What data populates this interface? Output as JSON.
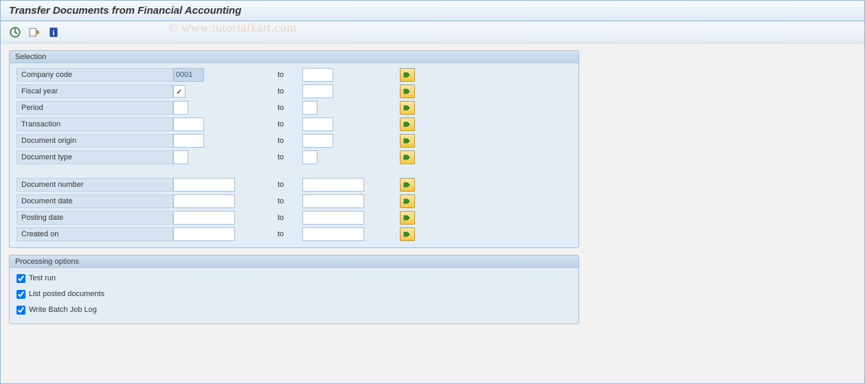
{
  "title": "Transfer Documents from Financial Accounting",
  "watermark": "© www.tutorialkart.com",
  "groups": {
    "selection": {
      "title": "Selection",
      "rows": {
        "company_code": {
          "label": "Company code",
          "from": "0001",
          "to": "",
          "width_from": 45,
          "width_to": 45,
          "to_label": "to"
        },
        "fiscal_year": {
          "label": "Fiscal year",
          "from_checked": true,
          "to": "",
          "width_to": 45,
          "to_label": "to"
        },
        "period": {
          "label": "Period",
          "from": "",
          "to": "",
          "width_from": 22,
          "width_to": 22,
          "to_label": "to"
        },
        "transaction": {
          "label": "Transaction",
          "from": "",
          "to": "",
          "width_from": 45,
          "width_to": 45,
          "to_label": "to"
        },
        "doc_origin": {
          "label": "Document origin",
          "from": "",
          "to": "",
          "width_from": 45,
          "width_to": 45,
          "to_label": "to"
        },
        "doc_type": {
          "label": "Document type",
          "from": "",
          "to": "",
          "width_from": 22,
          "width_to": 22,
          "to_label": "to"
        },
        "doc_number": {
          "label": "Document number",
          "from": "",
          "to": "",
          "width_from": 90,
          "width_to": 90,
          "to_label": "to"
        },
        "doc_date": {
          "label": "Document date",
          "from": "",
          "to": "",
          "width_from": 90,
          "width_to": 90,
          "to_label": "to"
        },
        "posting_date": {
          "label": "Posting date",
          "from": "",
          "to": "",
          "width_from": 90,
          "width_to": 90,
          "to_label": "to"
        },
        "created_on": {
          "label": "Created on",
          "from": "",
          "to": "",
          "width_from": 90,
          "width_to": 90,
          "to_label": "to"
        }
      }
    },
    "processing": {
      "title": "Processing options",
      "options": {
        "test_run": {
          "label": "Test run",
          "checked": true
        },
        "list_posted": {
          "label": "List posted documents",
          "checked": true
        },
        "write_log": {
          "label": "Write Batch Job Log",
          "checked": true
        }
      }
    }
  }
}
